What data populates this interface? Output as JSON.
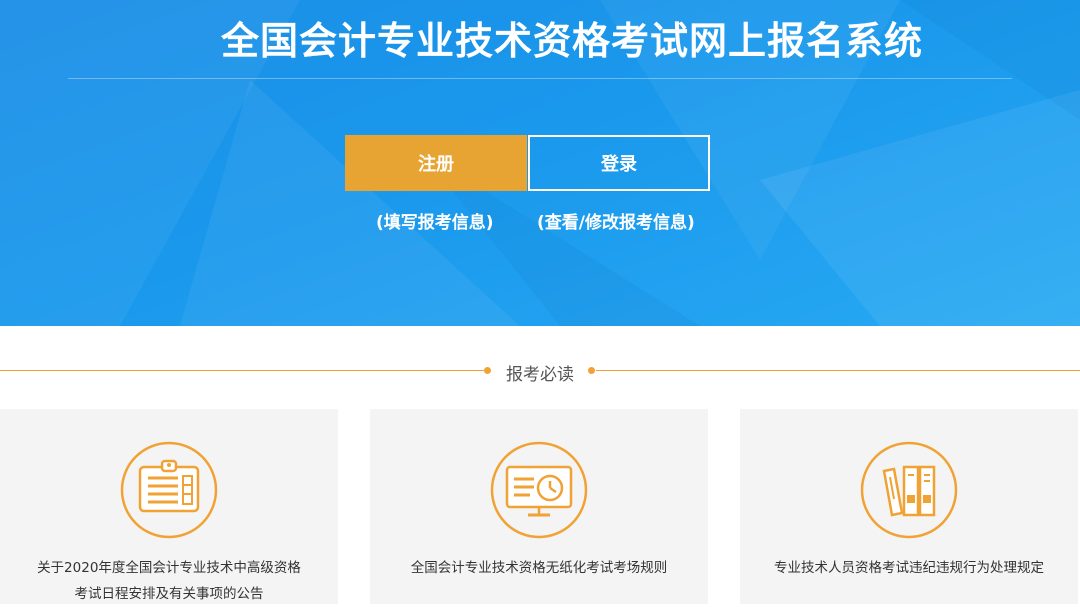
{
  "header": {
    "title": "全国会计专业技术资格考试网上报名系统",
    "register_label": "注册",
    "login_label": "登录",
    "register_sub": "(填写报考信息)",
    "login_sub": "(查看/修改报考信息)"
  },
  "notice": {
    "section_title": "报考必读",
    "cards": [
      {
        "icon": "clipboard-icon",
        "title_line1": "关于2020年度全国会计专业技术中高级资格",
        "title_line2": "考试日程安排及有关事项的公告"
      },
      {
        "icon": "monitor-clock-icon",
        "title_line1": "全国会计专业技术资格无纸化考试考场规则",
        "title_line2": ""
      },
      {
        "icon": "books-icon",
        "title_line1": "专业技术人员资格考试违纪违规行为处理规定",
        "title_line2": ""
      }
    ]
  },
  "colors": {
    "hero_blue": "#1a98ec",
    "accent_orange": "#e8a432",
    "card_bg": "#f4f4f4"
  }
}
